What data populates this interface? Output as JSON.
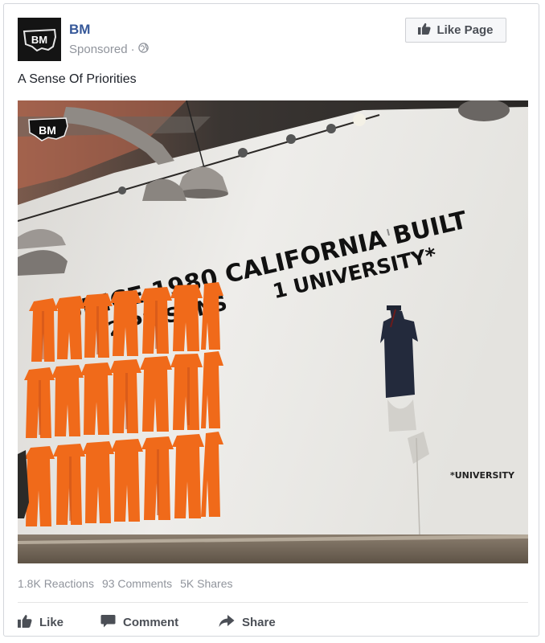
{
  "post": {
    "page_name": "BM",
    "avatar_text": "BM",
    "sponsored_label": "Sponsored",
    "separator": "·",
    "like_page_label": "Like Page",
    "caption": "A Sense Of Priorities"
  },
  "photo": {
    "logo_text": "BM",
    "wall_text_line1": "SINCE 1980 CALIFORNIA BUILT",
    "wall_text_line2": "22 PRISONS",
    "wall_text_line3": "1 UNIVERSITY*",
    "footnote": "*UNIVERSITY"
  },
  "stats": {
    "reactions": "1.8K Reactions",
    "comments": "93 Comments",
    "shares": "5K Shares"
  },
  "actions": {
    "like": "Like",
    "comment": "Comment",
    "share": "Share"
  },
  "colors": {
    "link_blue": "#365899",
    "muted": "#90949c",
    "action_text": "#4b4f56",
    "jumpsuit_orange": "#f26a1b"
  },
  "icons": [
    "globe-icon",
    "thumbs-up-icon",
    "comment-icon",
    "share-icon"
  ]
}
